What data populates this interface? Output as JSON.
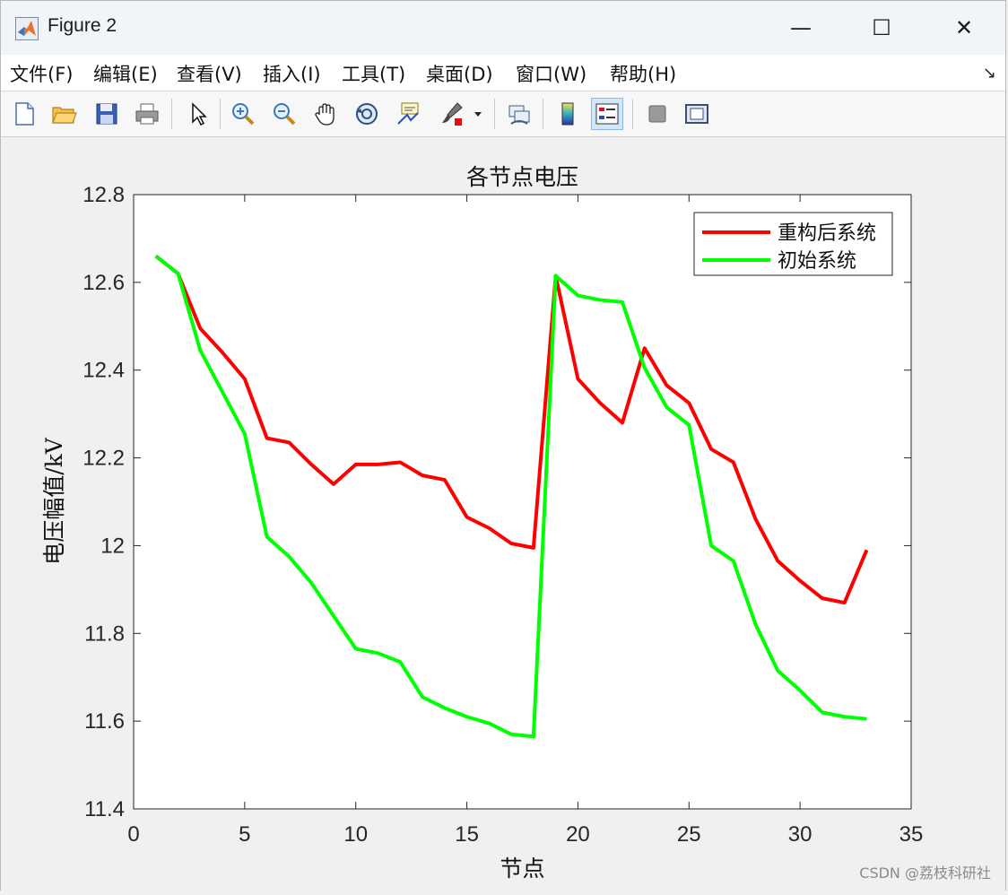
{
  "window": {
    "title": "Figure 2",
    "minimize_label": "—",
    "maximize_label": "☐",
    "close_label": "✕"
  },
  "menu": {
    "items": [
      "文件(F)",
      "编辑(E)",
      "查看(V)",
      "插入(I)",
      "工具(T)",
      "桌面(D)",
      "窗口(W)",
      "帮助(H)"
    ]
  },
  "toolbar": {
    "buttons": [
      {
        "icon": "new-file-icon"
      },
      {
        "icon": "open-folder-icon"
      },
      {
        "icon": "save-icon"
      },
      {
        "icon": "print-icon"
      },
      {
        "icon": "pointer-icon"
      },
      {
        "icon": "zoom-in-icon"
      },
      {
        "icon": "zoom-out-icon"
      },
      {
        "icon": "pan-hand-icon"
      },
      {
        "icon": "rotate-3d-icon"
      },
      {
        "icon": "data-cursor-icon"
      },
      {
        "icon": "brush-icon"
      },
      {
        "icon": "link-plot-icon"
      },
      {
        "icon": "colorbar-icon"
      },
      {
        "icon": "legend-icon",
        "active": true
      },
      {
        "icon": "hide-plot-tools-icon"
      },
      {
        "icon": "show-plot-tools-icon"
      }
    ]
  },
  "colors": {
    "reconfigured": "#ff0000",
    "initial": "#00ff00"
  },
  "watermark": "CSDN @荔枝科研社",
  "chart_data": {
    "type": "line",
    "title": "各节点电压",
    "xlabel": "节点",
    "ylabel": "电压幅值/kV",
    "xlim": [
      0,
      35
    ],
    "ylim": [
      11.4,
      12.8
    ],
    "xticks": [
      0,
      5,
      10,
      15,
      20,
      25,
      30,
      35
    ],
    "yticks": [
      11.4,
      11.6,
      11.8,
      12,
      12.2,
      12.4,
      12.6,
      12.8
    ],
    "ytick_labels": [
      "11.4",
      "11.6",
      "11.8",
      "12",
      "12.2",
      "12.4",
      "12.6",
      "12.8"
    ],
    "grid": false,
    "legend_position": "top-right",
    "x": [
      1,
      2,
      3,
      4,
      5,
      6,
      7,
      8,
      9,
      10,
      11,
      12,
      13,
      14,
      15,
      16,
      17,
      18,
      19,
      20,
      21,
      22,
      23,
      24,
      25,
      26,
      27,
      28,
      29,
      30,
      31,
      32,
      33
    ],
    "series": [
      {
        "name": "重构后系统",
        "color": "#ff0000",
        "values": [
          12.66,
          12.62,
          12.495,
          12.44,
          12.38,
          12.245,
          12.235,
          12.185,
          12.14,
          12.185,
          12.185,
          12.19,
          12.16,
          12.15,
          12.065,
          12.04,
          12.005,
          11.995,
          12.615,
          12.38,
          12.325,
          12.28,
          12.45,
          12.365,
          12.325,
          12.22,
          12.19,
          12.06,
          11.965,
          11.92,
          11.88,
          11.87,
          11.99
        ]
      },
      {
        "name": "初始系统",
        "color": "#00ff00",
        "values": [
          12.66,
          12.62,
          12.445,
          12.35,
          12.255,
          12.02,
          11.975,
          11.915,
          11.84,
          11.765,
          11.755,
          11.735,
          11.655,
          11.63,
          11.61,
          11.595,
          11.57,
          11.565,
          12.615,
          12.57,
          12.56,
          12.555,
          12.405,
          12.315,
          12.275,
          12.0,
          11.965,
          11.82,
          11.715,
          11.67,
          11.62,
          11.61,
          11.605
        ]
      }
    ]
  }
}
